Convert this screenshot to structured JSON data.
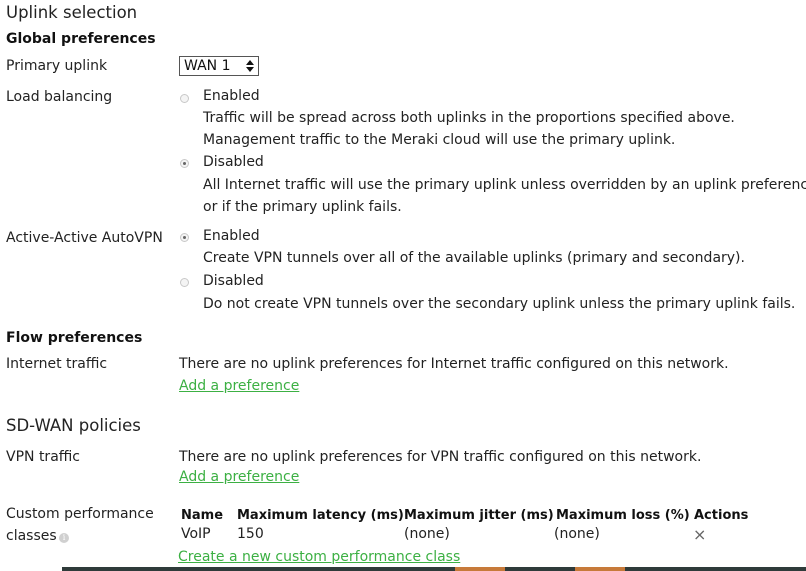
{
  "section": {
    "title": "Uplink selection"
  },
  "global": {
    "heading": "Global preferences",
    "primary_uplink": {
      "label": "Primary uplink",
      "selected": "WAN 1"
    },
    "load_balancing": {
      "label": "Load balancing",
      "options": [
        {
          "label": "Enabled",
          "checked": false,
          "desc": [
            "Traffic will be spread across both uplinks in the proportions specified above.",
            "Management traffic to the Meraki cloud will use the primary uplink."
          ]
        },
        {
          "label": "Disabled",
          "checked": true,
          "desc": [
            "All Internet traffic will use the primary uplink unless overridden by an uplink preference",
            "or if the  primary uplink fails."
          ]
        }
      ]
    },
    "autovpn": {
      "label": "Active-Active AutoVPN",
      "options": [
        {
          "label": "Enabled",
          "checked": true,
          "desc": [
            "Create VPN tunnels over all of the available uplinks (primary and secondary)."
          ]
        },
        {
          "label": "Disabled",
          "checked": false,
          "desc": [
            "Do not create VPN tunnels over the secondary uplink unless the primary uplink fails."
          ]
        }
      ]
    }
  },
  "flow": {
    "heading": "Flow preferences",
    "internet": {
      "label": "Internet traffic",
      "text": "There are no uplink preferences for Internet traffic configured on this network.",
      "link": "Add a preference "
    }
  },
  "sdwan": {
    "heading": "SD-WAN policies",
    "vpn": {
      "label": "VPN traffic",
      "text": "There are no uplink preferences for VPN traffic configured on this network.",
      "link": "Add a preference "
    },
    "custom": {
      "label_line1": "Custom performance",
      "label_line2": "classes",
      "info_icon": "info-icon",
      "columns": [
        "Name",
        "Maximum latency (ms)",
        "Maximum jitter (ms)",
        "Maximum loss (%)",
        "Actions"
      ],
      "rows": [
        {
          "name": "VoIP",
          "latency": "150",
          "jitter": "(none)",
          "loss": "(none)",
          "action_icon": "×"
        }
      ],
      "create_link": "Create a new custom performance class"
    }
  },
  "colors": {
    "link": "#3cb043",
    "bar_dark": "#2f3b3a",
    "bar_orange": "#c77a3a"
  }
}
